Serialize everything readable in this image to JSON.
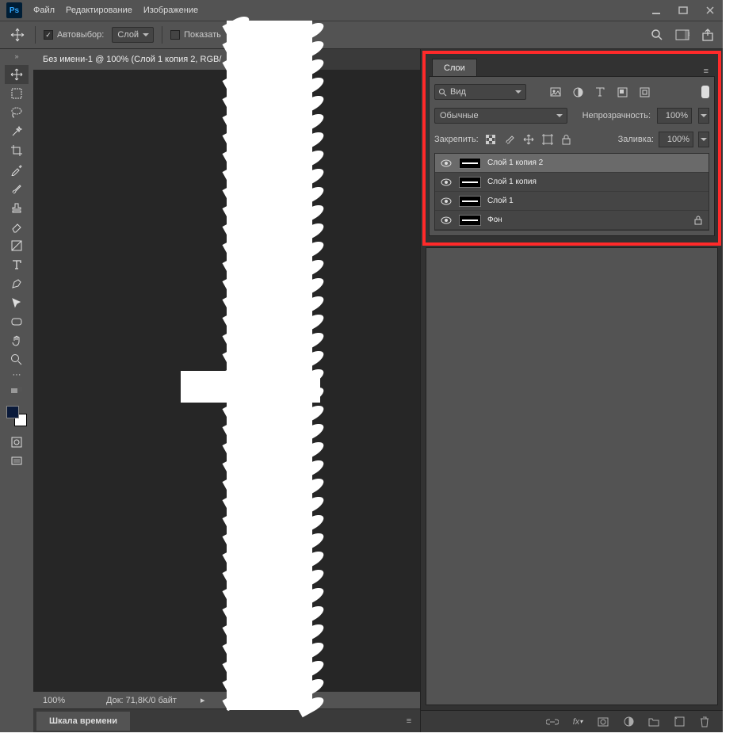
{
  "menubar": {
    "file": "Файл",
    "edit": "Редактирование",
    "image": "Изображение"
  },
  "options": {
    "auto_select": "Автовыбор:",
    "auto_target": "Слой",
    "show": "Показать"
  },
  "document": {
    "tab_title": "Без имени-1 @ 100% (Слой 1 копия 2, RGB/"
  },
  "status": {
    "zoom": "100%",
    "doc_info": "Док: 71,8K/0 байт"
  },
  "bottom_tab": {
    "timeline": "Шкала времени"
  },
  "layers_panel": {
    "tab": "Слои",
    "search_label": "Вид",
    "blend_mode": "Обычные",
    "opacity_label": "Непрозрачность:",
    "opacity_value": "100%",
    "lock_label": "Закрепить:",
    "fill_label": "Заливка:",
    "fill_value": "100%",
    "layers": [
      {
        "name": "Слой 1 копия 2",
        "selected": true,
        "locked": false
      },
      {
        "name": "Слой 1 копия",
        "selected": false,
        "locked": false
      },
      {
        "name": "Слой 1",
        "selected": false,
        "locked": false
      },
      {
        "name": "Фон",
        "selected": false,
        "locked": true
      }
    ]
  }
}
